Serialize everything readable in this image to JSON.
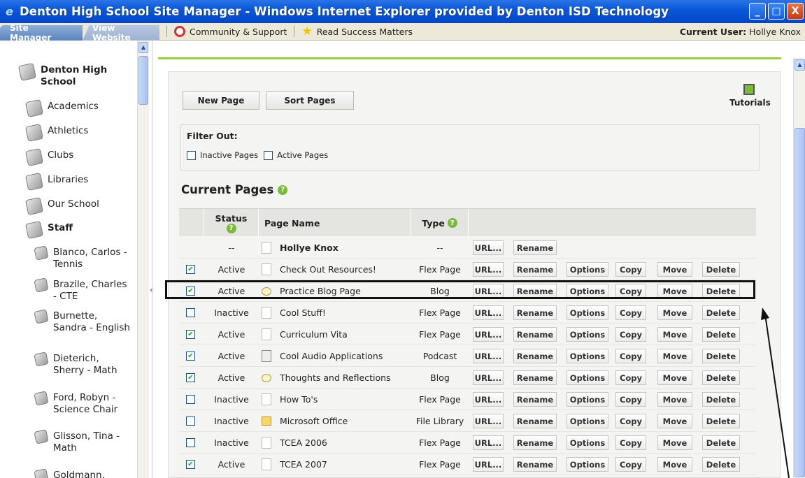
{
  "window": {
    "title": "Denton High School Site Manager - Windows Internet Explorer provided by Denton ISD Technology",
    "minimize": "_",
    "maximize": "□",
    "close": "X"
  },
  "tabs": [
    {
      "label": "Site Manager",
      "active": true
    },
    {
      "label": "View Website",
      "active": false
    }
  ],
  "toolbar": {
    "community": "Community & Support",
    "read": "Read Success Matters",
    "current_user_label": "Current User:",
    "current_user": "Hollye Knox"
  },
  "sidebar": {
    "root": "Denton High School",
    "items": [
      "Academics",
      "Athletics",
      "Clubs",
      "Libraries",
      "Our School"
    ],
    "staff": "Staff",
    "staff_items": [
      "Blanco, Carlos - Tennis",
      "Brazile, Charles - CTE",
      "Burnette, Sandra - English",
      "Dieterich, Sherry - Math",
      "Ford, Robyn - Science Chair",
      "Glisson, Tina - Math",
      "Goldmann,"
    ],
    "collapse": "‹"
  },
  "main": {
    "new_page": "New Page",
    "sort_pages": "Sort Pages",
    "tutorials": "Tutorials",
    "filter_label": "Filter Out:",
    "filter_inactive": "Inactive Pages",
    "filter_active": "Active Pages",
    "current_pages": "Current Pages"
  },
  "table": {
    "headers": {
      "status": "Status",
      "page_name": "Page Name",
      "type": "Type"
    },
    "buttons": {
      "url": "URL...",
      "rename": "Rename",
      "options": "Options",
      "copy": "Copy",
      "move": "Move",
      "delete": "Delete"
    },
    "rows": [
      {
        "checked": null,
        "status": "--",
        "icon": "page",
        "name": "Hollye Knox",
        "type": "--",
        "bold": true,
        "full": false
      },
      {
        "checked": true,
        "status": "Active",
        "icon": "page",
        "name": "Check Out Resources!",
        "type": "Flex Page",
        "full": true
      },
      {
        "checked": true,
        "status": "Active",
        "icon": "blog",
        "name": "Practice Blog Page",
        "type": "Blog",
        "full": true
      },
      {
        "checked": false,
        "status": "Inactive",
        "icon": "page",
        "name": "Cool Stuff!",
        "type": "Flex Page",
        "full": true
      },
      {
        "checked": true,
        "status": "Active",
        "icon": "page",
        "name": "Curriculum Vita",
        "type": "Flex Page",
        "full": true
      },
      {
        "checked": true,
        "status": "Active",
        "icon": "pod",
        "name": "Cool Audio Applications",
        "type": "Podcast",
        "full": true
      },
      {
        "checked": true,
        "status": "Active",
        "icon": "blog",
        "name": "Thoughts and Reflections",
        "type": "Blog",
        "full": true
      },
      {
        "checked": false,
        "status": "Inactive",
        "icon": "page",
        "name": "How To's",
        "type": "Flex Page",
        "full": true
      },
      {
        "checked": false,
        "status": "Inactive",
        "icon": "lib",
        "name": "Microsoft Office",
        "type": "File Library",
        "full": true
      },
      {
        "checked": false,
        "status": "Inactive",
        "icon": "page",
        "name": "TCEA 2006",
        "type": "Flex Page",
        "full": true
      },
      {
        "checked": true,
        "status": "Active",
        "icon": "page",
        "name": "TCEA 2007",
        "type": "Flex Page",
        "full": true
      }
    ]
  }
}
